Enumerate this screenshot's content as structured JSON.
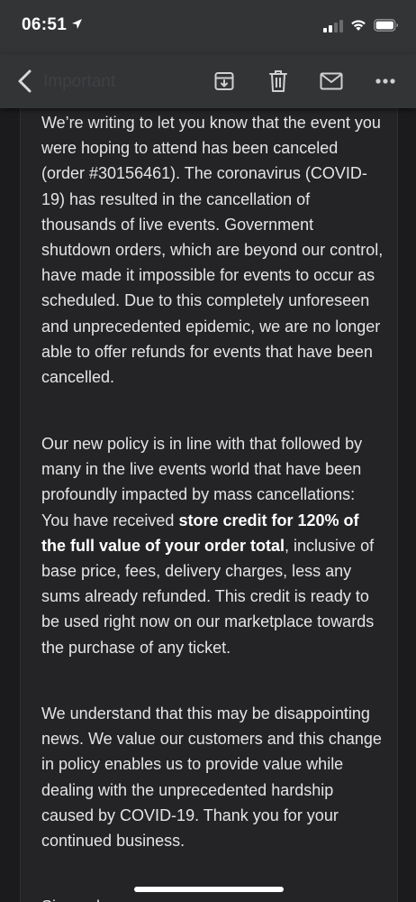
{
  "status_bar": {
    "time": "06:51"
  },
  "toolbar": {
    "title": "Important",
    "icons": {
      "back": "chevron-left-icon",
      "archive": "archive-icon",
      "delete": "trash-icon",
      "mark_unread": "mail-icon",
      "more": "more-horizontal-icon"
    }
  },
  "email": {
    "paragraph1": "We’re writing to let you know that the event you were hoping to attend has been canceled (order #30156461). The coronavirus (COVID-19) has resulted in the cancellation of thousands of live events. Government shutdown orders, which are beyond our control, have made it impossible for events to occur as scheduled. Due to this completely unforeseen and unprecedented epidemic, we are no longer able to offer refunds for events that have been cancelled.",
    "paragraph2_before": "Our new policy is in line with that followed by many in the live events world that have been profoundly impacted by mass cancellations: You have received ",
    "paragraph2_bold": "store credit for 120% of the full value of your order total",
    "paragraph2_after": ", inclusive of base price, fees, delivery charges, less any sums already refunded. This credit is ready to be used right now on our marketplace towards the purchase of any ticket.",
    "paragraph3": "We understand that this may be disappointing news. We value our customers and this change in policy enables us to provide value while dealing with the unprecedented hardship caused by COVID-19. Thank you for your continued business.",
    "closing": "Sincerely,"
  },
  "colors": {
    "bars": "#333436",
    "background": "#1b1b1d",
    "card": "#242426",
    "text": "#e4e4e6"
  }
}
